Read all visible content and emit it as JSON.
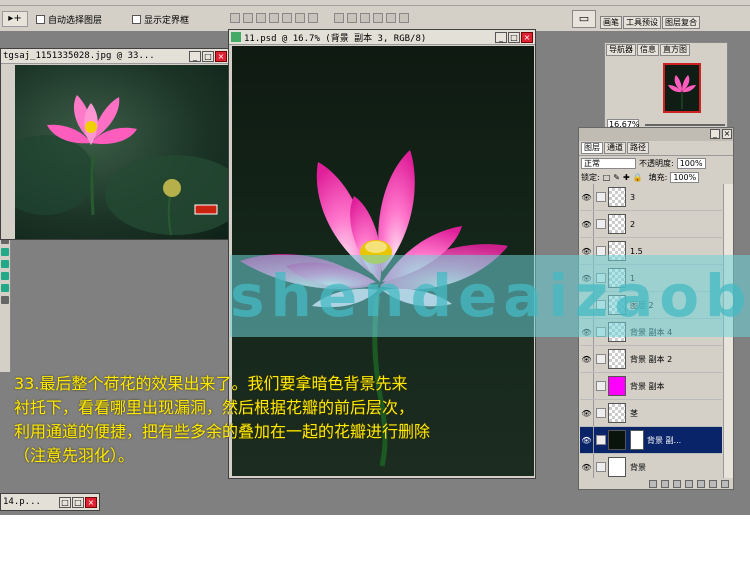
{
  "options_bar": {
    "tool_glyph": "▸+",
    "auto_select_label": "自动选择图层",
    "show_bounds_label": "显示定界框"
  },
  "palette_tabs": [
    "画笔",
    "工具预设",
    "图层复合"
  ],
  "windows": {
    "source": {
      "title": "tgsaj_1151335028.jpg @ 33..."
    },
    "main": {
      "title": "11.psd @ 16.7% (背景 副本 3, RGB/8)"
    },
    "minimized": {
      "title": "14.p..."
    }
  },
  "navigator": {
    "tabs": [
      "导航器",
      "信息",
      "直方图"
    ],
    "zoom": "16.67%"
  },
  "layers_panel": {
    "tabs": [
      "图层",
      "通道",
      "路径"
    ],
    "blend_mode": "正常",
    "opacity_label": "不透明度:",
    "opacity": "100%",
    "lock_label": "锁定:",
    "fill_label": "填充:",
    "fill": "100%",
    "layers": [
      {
        "name": "3",
        "visible": true,
        "thumb": "checker",
        "active": false
      },
      {
        "name": "2",
        "visible": true,
        "thumb": "checker",
        "active": false
      },
      {
        "name": "1.5",
        "visible": true,
        "thumb": "checker",
        "active": false
      },
      {
        "name": "1",
        "visible": true,
        "thumb": "checker",
        "active": false
      },
      {
        "name": "图层 2",
        "visible": false,
        "thumb": "checker",
        "active": false
      },
      {
        "name": "背景 副本 4",
        "visible": true,
        "thumb": "checker",
        "active": false
      },
      {
        "name": "背景 副本 2",
        "visible": true,
        "thumb": "checker",
        "active": false
      },
      {
        "name": "背景 副本",
        "visible": false,
        "thumb": "magenta",
        "active": false
      },
      {
        "name": "茎",
        "visible": true,
        "thumb": "checker",
        "active": false
      },
      {
        "name": "背景 副...",
        "visible": true,
        "thumb": "black",
        "active": true
      },
      {
        "name": "背景",
        "visible": true,
        "thumb": "white",
        "active": false
      }
    ]
  },
  "watermark": "shendeaizaobe",
  "instruction": [
    "33.最后整个荷花的效果出来了。我们要拿暗色背景先来",
    "衬托下，看看哪里出现漏洞，然后根据花瓣的前后层次，",
    "利用通道的便捷，把有些多余的叠加在一起的花瓣进行删除",
    "（注意先羽化）。"
  ],
  "colors": {
    "instruction_text": "#ffea00",
    "watermark_band": "#6ed2d7",
    "petal": "#ff4fb8",
    "active_layer": "#0a246a"
  }
}
